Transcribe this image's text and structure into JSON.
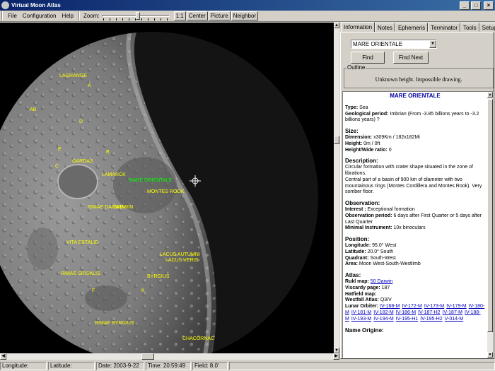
{
  "app": {
    "title": "Virtual Moon Atlas"
  },
  "menu": {
    "items": [
      "File",
      "Configuration",
      "Help"
    ]
  },
  "toolbar": {
    "zoom_label": "Zoom:",
    "btn_1to1": "1:1",
    "btn_center": "Center",
    "btn_picture": "Picture",
    "btn_neighbor": "Neighbor"
  },
  "tabs": [
    "Information",
    "Notes",
    "Ephemeris",
    "Terminator",
    "Tools",
    "Setup"
  ],
  "search": {
    "value": "MARE ORIENTALE",
    "find": "Find",
    "find_next": "Find Next"
  },
  "outline": {
    "legend": "Outline",
    "message": "Unknown height. Impossible drawing."
  },
  "info": {
    "title": "MARE ORIENTALE",
    "type_label": "Type:",
    "type_value": "Sea",
    "geo_label": "Geological period:",
    "geo_value": "Imbrian (From -3.85 billions years to -3.2 billions years) ?",
    "size_heading": "Size:",
    "dimension_label": "Dimension:",
    "dimension_value": "x309Km / 182x182Mi",
    "height_label": "Height:",
    "height_value": "0m / 0ft",
    "ratio_label": "Height/Wide ratio:",
    "ratio_value": "0",
    "desc_heading": "Description:",
    "desc_1": "Circular formation with crater shape situated in the zone of librations.",
    "desc_2": "Central part of a basin of 900 km of diameter with two mountainous rings (Montes Cordillera and Montes Rook). Very somber floor.",
    "obs_heading": "Observation:",
    "interest_label": "Interest :",
    "interest_value": "Exceptional formation",
    "period_label": "Observation period:",
    "period_value": "6 days after First Quarter or 5 days after Last Quarter",
    "instrument_label": "Minimal Instrument:",
    "instrument_value": "10x binoculars",
    "pos_heading": "Position:",
    "longitude_label": "Longitude:",
    "longitude_value": "95.0° West",
    "latitude_label": "Latitude:",
    "latitude_value": "20.0° South",
    "quadrant_label": "Quadrant:",
    "quadrant_value": "South-West",
    "area_label": "Area:",
    "area_value": "Moon West-South-Westlimb",
    "atlas_heading": "Atlas:",
    "rukl_label": "Rukl map:",
    "rukl_value": "50 Darwin",
    "viscardy_label": "Viscardy page:",
    "viscardy_value": "187",
    "hatfield_label": "Hatfield map:",
    "hatfield_value": "",
    "westfall_label": "Westfall Atlas:",
    "westfall_value": "Q3/V",
    "orbiter_label": "Lunar Orbiter:",
    "orbiter_links": [
      "IV-168-M",
      "IV-172-M",
      "IV-173-M",
      "IV-179-M",
      "IV-180-M",
      "IV-181-M",
      "IV-182-M",
      "IV-186-M",
      "IV-187-H2",
      "IV-187-M",
      "IV-188-M",
      "IV-193-M",
      "IV-194-M",
      "IV-195-H1",
      "IV-195-H2",
      "V-014-M"
    ],
    "name_origin_heading": "Name Origine:"
  },
  "map_labels": [
    {
      "text": "LAGRANGE",
      "color": "yellow"
    },
    {
      "text": "A",
      "color": "yellow"
    },
    {
      "text": "AB",
      "color": "yellow"
    },
    {
      "text": "E",
      "color": "yellow"
    },
    {
      "text": "D",
      "color": "yellow"
    },
    {
      "text": "B",
      "color": "yellow"
    },
    {
      "text": "C",
      "color": "yellow"
    },
    {
      "text": "GARDAS",
      "color": "yellow"
    },
    {
      "text": "LAMARCK",
      "color": "yellow"
    },
    {
      "text": "MARE ORIENTALE",
      "color": "green"
    },
    {
      "text": "MONTES ROOK",
      "color": "yellow"
    },
    {
      "text": "RIMAE DARWIN",
      "color": "yellow"
    },
    {
      "text": "DARWIN",
      "color": "yellow"
    },
    {
      "text": "VITA ESTALIE",
      "color": "yellow"
    },
    {
      "text": "LACUS AUTUMNI",
      "color": "yellow"
    },
    {
      "text": "LACUS VERIS",
      "color": "yellow"
    },
    {
      "text": "RIMAE SIRSALIS",
      "color": "yellow"
    },
    {
      "text": "RIMAE BYRGIUS",
      "color": "yellow"
    },
    {
      "text": "BYRGIUS",
      "color": "yellow"
    },
    {
      "text": "CHACORNAC",
      "color": "yellow"
    },
    {
      "text": "F",
      "color": "yellow"
    },
    {
      "text": "K",
      "color": "yellow"
    }
  ],
  "status": {
    "longitude": "Longitude:",
    "latitude": "Latitude:",
    "date": "Date:  2003-9-22",
    "time": "Time:  20:59:49",
    "field": "Field:  8.0'"
  }
}
